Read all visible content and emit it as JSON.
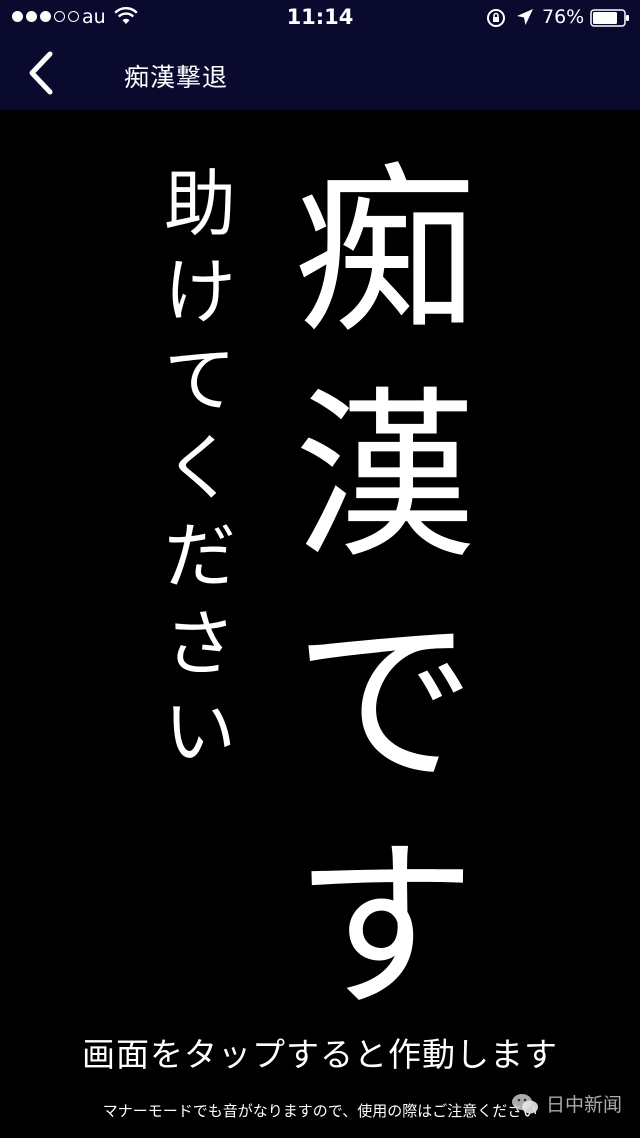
{
  "status_bar": {
    "carrier": "au",
    "time": "11:14",
    "battery_percent": "76%",
    "signal_bars_filled": 3,
    "signal_bars_total": 5
  },
  "nav": {
    "title": "痴漢撃退",
    "back_icon": "chevron-left-icon"
  },
  "main": {
    "big_text": [
      "痴",
      "漢",
      "で",
      "す"
    ],
    "small_text": [
      "助",
      "け",
      "て",
      "く",
      "だ",
      "さ",
      "い"
    ],
    "instruction": "画面をタップすると作動します",
    "notice": "マナーモードでも音がなりますので、使用の際はご注意ください"
  },
  "watermark": {
    "text": "日中新闻"
  },
  "colors": {
    "nav_background": "#0a0a2e",
    "page_background": "#000000",
    "text": "#ffffff"
  }
}
